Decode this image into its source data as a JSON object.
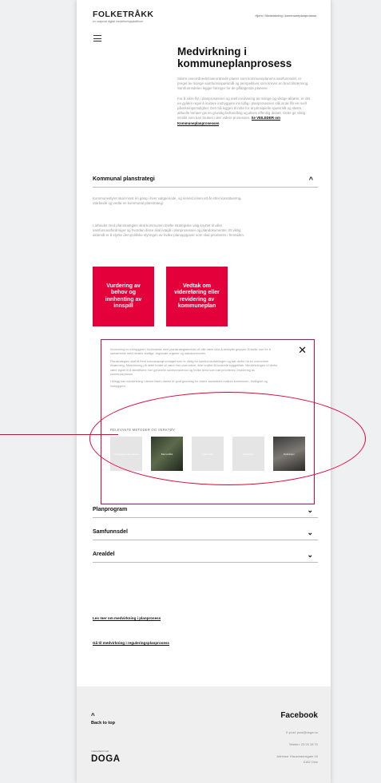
{
  "header": {
    "logo": "FOLKETRÅKK",
    "tagline": "en nasjonal digital medvirkningsplattform",
    "breadcrumb": "Hjem / Medvirkning i kommuneplanprosess"
  },
  "main": {
    "title": "Medvirkning i kommuneplanprosess",
    "intro_p1": "Større overordnede/overordnede planer som kommuneplanens samfunnsdel, er preget av mange samfunnsspørsmål og perspektiver som krever en bred tilnærming. Samfunnsdelen legger føringer for de påfølgende planene.",
    "intro_p2": "For å sikre flyt i planprosessen og reell involvering av mange og viktige aktører, er det en gylden regel å invitere innbyggere inn tidlig i planprosessen slik at de får en reell påvirkningsmulighet. Det må legges til rette for at prinsipielle spørsmål og større, aktuelle temaer gis en grundig behandling og økres offentlig debatt. Dette gir viktig innsikt som kan brukes i den videre prosessen.",
    "intro_link": "Se VEILEDER om Kommuneplanprosessen"
  },
  "sections": {
    "strategi": {
      "label": "Kommunal planstrategi",
      "chevron": "^",
      "p1": "Kommunestyret skal minst én gang i hver valgperiode, og senest innen ett år etter konstituering, utarbeide og vedta en kommunal planstrategi.",
      "p2": "I arbeidet med planstrategien skal kommunen drøfte strategiske valg knyttet til ulike samfunnsutfordringer og hvordan disse skal ivtagå i planprosesser og plandokumenter. Et viktig aktamål er å styrke den politiske styringen av hvilke planoppgaver som skal prioriteres i fremtiden."
    },
    "tile1": "Vurdering av behov og innhenting av innspill",
    "tile2": "Vedtak om videreføring eller revidering av kommuneplan",
    "planprogram": {
      "label": "Planprogram",
      "chevron": "⌄"
    },
    "samfunnsdel": {
      "label": "Samfunnsdel",
      "chevron": "⌄"
    },
    "arealdel": {
      "label": "Arealdel",
      "chevron": "⌄"
    }
  },
  "overlay": {
    "close": "✕",
    "p1": "Involvering av innbyggere i forbindelse med planstrategiarbeidet vil ofte være ikke-å-beskytte grupper. Enkelte rom for å samarbeide med berørte statlige, regionale organer og nabokommuner.",
    "p2": "Planstrategien skal få frem kunnskapsgrunnlaget som er viktig for samfunnsutviklingen og bør derfor ha en overordnet tilnærming. Medvirkning på dette nivået vil være mer overordnet, ikke knyttet til konkrete byggetiltak. Medvirkningen vil derfor være egnet til å identifisere mer generelle samfunnsbehov og hvilke tema som bør prioriteres i revidering av kommuneplanen.",
    "p3": "I tillegg kan medvirkning i denne fasen danne et godt grunnlag for videre samarbeid mellom kommunen, frivillighet og innbyggere.",
    "methods_label": "RELEVANTE METODER OG VERKTØY",
    "methods": [
      "Innbyggerundersøkelse",
      "Barnetråkk",
      "Folkemøte",
      "Workshop",
      "Refleksjon"
    ]
  },
  "links": {
    "link1": "Les mer om medvirkning i planprosess",
    "link2": "Gå til medvirkning i reguleringsplanprosess"
  },
  "footer": {
    "back_to_top": "Back to top",
    "arrow": "^",
    "facebook": "Facebook",
    "email": "E-post: post@doga.no",
    "phone": "Telefon: 23 29 28 70",
    "address_1": "Adresse: Hausmannsgate 16",
    "address_2": "0182 Oslo",
    "doga_tag": "i samarbeid med",
    "doga": "DOGA"
  },
  "colors": {
    "accent": "#e4003a",
    "page_bg": "#ffffff",
    "outer_bg": "#eef0f1",
    "footer_bg": "#efefef"
  }
}
